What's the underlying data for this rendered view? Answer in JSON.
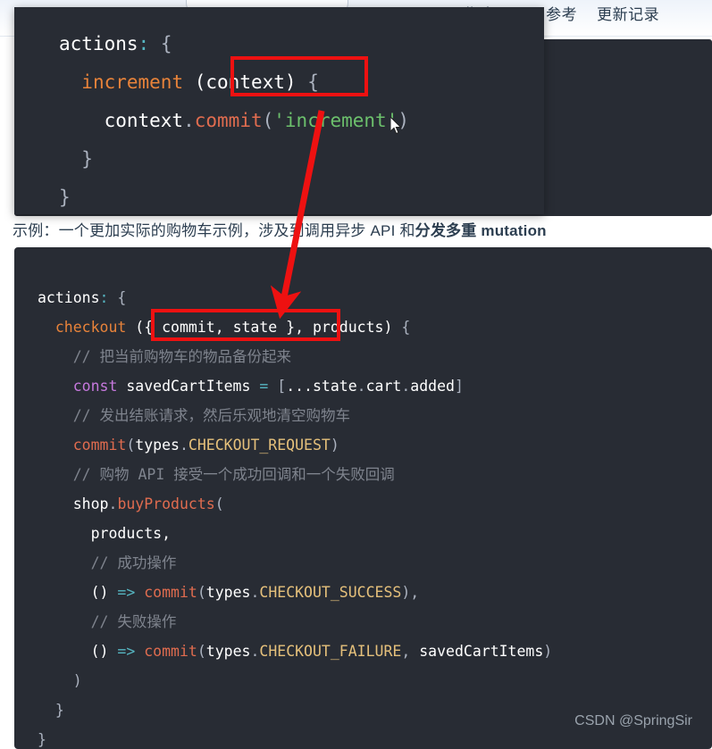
{
  "nav": {
    "links": [
      {
        "label": "指南"
      },
      {
        "label": "API 参考"
      },
      {
        "label": "更新记录"
      }
    ]
  },
  "background": {
    "paragraph": "示例：一个更加实际的购物车示例，涉及到调用异步 API 和分发多重 mutation",
    "paragraph_bold_part": "分发多重 mutation"
  },
  "overlay_code": {
    "language": "javascript",
    "lines": [
      [
        {
          "t": "actions",
          "c": "white"
        },
        {
          "t": ":",
          "c": "colon"
        },
        {
          "t": " {",
          "c": "punct"
        }
      ],
      [
        {
          "t": "  ",
          "c": "plain"
        },
        {
          "t": "increment",
          "c": "fn2"
        },
        {
          "t": " ",
          "c": "plain"
        },
        {
          "t": "(context)",
          "c": "white"
        },
        {
          "t": " {",
          "c": "punct"
        }
      ],
      [
        {
          "t": "    ",
          "c": "plain"
        },
        {
          "t": "context",
          "c": "white"
        },
        {
          "t": ".",
          "c": "punct"
        },
        {
          "t": "commit",
          "c": "fn"
        },
        {
          "t": "(",
          "c": "punct"
        },
        {
          "t": "'increment'",
          "c": "str"
        },
        {
          "t": ")",
          "c": "punct"
        }
      ],
      [
        {
          "t": "  }",
          "c": "punct"
        }
      ],
      [
        {
          "t": "}",
          "c": "punct"
        }
      ]
    ]
  },
  "main_code": {
    "language": "javascript",
    "lines": [
      [
        {
          "t": "actions",
          "c": "white"
        },
        {
          "t": ":",
          "c": "colon"
        },
        {
          "t": " {",
          "c": "punct"
        }
      ],
      [
        {
          "t": "  ",
          "c": "plain"
        },
        {
          "t": "checkout",
          "c": "fn2"
        },
        {
          "t": " ",
          "c": "plain"
        },
        {
          "t": "({ commit, state }, products)",
          "c": "white"
        },
        {
          "t": " {",
          "c": "punct"
        }
      ],
      [
        {
          "t": "    ",
          "c": "plain"
        },
        {
          "t": "// 把当前购物车的物品备份起来",
          "c": "comment"
        }
      ],
      [
        {
          "t": "    ",
          "c": "plain"
        },
        {
          "t": "const",
          "c": "key"
        },
        {
          "t": " savedCartItems ",
          "c": "white"
        },
        {
          "t": "=",
          "c": "colon"
        },
        {
          "t": " [",
          "c": "punct"
        },
        {
          "t": "...",
          "c": "white"
        },
        {
          "t": "state",
          "c": "white"
        },
        {
          "t": ".",
          "c": "punct"
        },
        {
          "t": "cart",
          "c": "white"
        },
        {
          "t": ".",
          "c": "punct"
        },
        {
          "t": "added",
          "c": "white"
        },
        {
          "t": "]",
          "c": "punct"
        }
      ],
      [
        {
          "t": "    ",
          "c": "plain"
        },
        {
          "t": "// 发出结账请求，然后乐观地清空购物车",
          "c": "comment"
        }
      ],
      [
        {
          "t": "    ",
          "c": "plain"
        },
        {
          "t": "commit",
          "c": "fn"
        },
        {
          "t": "(",
          "c": "punct"
        },
        {
          "t": "types",
          "c": "white"
        },
        {
          "t": ".",
          "c": "punct"
        },
        {
          "t": "CHECKOUT_REQUEST",
          "c": "const"
        },
        {
          "t": ")",
          "c": "punct"
        }
      ],
      [
        {
          "t": "    ",
          "c": "plain"
        },
        {
          "t": "// 购物 API 接受一个成功回调和一个失败回调",
          "c": "comment"
        }
      ],
      [
        {
          "t": "    ",
          "c": "plain"
        },
        {
          "t": "shop",
          "c": "white"
        },
        {
          "t": ".",
          "c": "punct"
        },
        {
          "t": "buyProducts",
          "c": "fn"
        },
        {
          "t": "(",
          "c": "punct"
        }
      ],
      [
        {
          "t": "      ",
          "c": "plain"
        },
        {
          "t": "products,",
          "c": "white"
        }
      ],
      [
        {
          "t": "      ",
          "c": "plain"
        },
        {
          "t": "// 成功操作",
          "c": "comment"
        }
      ],
      [
        {
          "t": "      ",
          "c": "plain"
        },
        {
          "t": "()",
          "c": "white"
        },
        {
          "t": " ",
          "c": "plain"
        },
        {
          "t": "=>",
          "c": "arrow"
        },
        {
          "t": " ",
          "c": "plain"
        },
        {
          "t": "commit",
          "c": "fn"
        },
        {
          "t": "(",
          "c": "punct"
        },
        {
          "t": "types",
          "c": "white"
        },
        {
          "t": ".",
          "c": "punct"
        },
        {
          "t": "CHECKOUT_SUCCESS",
          "c": "const"
        },
        {
          "t": "),",
          "c": "punct"
        }
      ],
      [
        {
          "t": "      ",
          "c": "plain"
        },
        {
          "t": "// 失败操作",
          "c": "comment"
        }
      ],
      [
        {
          "t": "      ",
          "c": "plain"
        },
        {
          "t": "()",
          "c": "white"
        },
        {
          "t": " ",
          "c": "plain"
        },
        {
          "t": "=>",
          "c": "arrow"
        },
        {
          "t": " ",
          "c": "plain"
        },
        {
          "t": "commit",
          "c": "fn"
        },
        {
          "t": "(",
          "c": "punct"
        },
        {
          "t": "types",
          "c": "white"
        },
        {
          "t": ".",
          "c": "punct"
        },
        {
          "t": "CHECKOUT_FAILURE",
          "c": "const"
        },
        {
          "t": ", ",
          "c": "punct"
        },
        {
          "t": "savedCartItems",
          "c": "white"
        },
        {
          "t": ")",
          "c": "punct"
        }
      ],
      [
        {
          "t": "    ",
          "c": "plain"
        },
        {
          "t": ")",
          "c": "punct"
        }
      ],
      [
        {
          "t": "  }",
          "c": "punct"
        }
      ],
      [
        {
          "t": "}",
          "c": "punct"
        }
      ]
    ]
  },
  "annotations": {
    "highlight_color": "#ee1111",
    "overlay_highlight_text": "(context)",
    "main_highlight_text": "({ commit, state },",
    "arrow_from": "overlay context argument",
    "arrow_to": "main destructured argument"
  },
  "watermark": {
    "text": "CSDN @SpringSir"
  },
  "colors": {
    "code_background": "#282c34",
    "page_background": "#ffffff",
    "accent_red": "#ee1111",
    "string_green": "#6cc06c",
    "function_orange": "#e06c4f",
    "constant_yellow": "#e5c07b",
    "comment_gray": "#7f848e"
  }
}
